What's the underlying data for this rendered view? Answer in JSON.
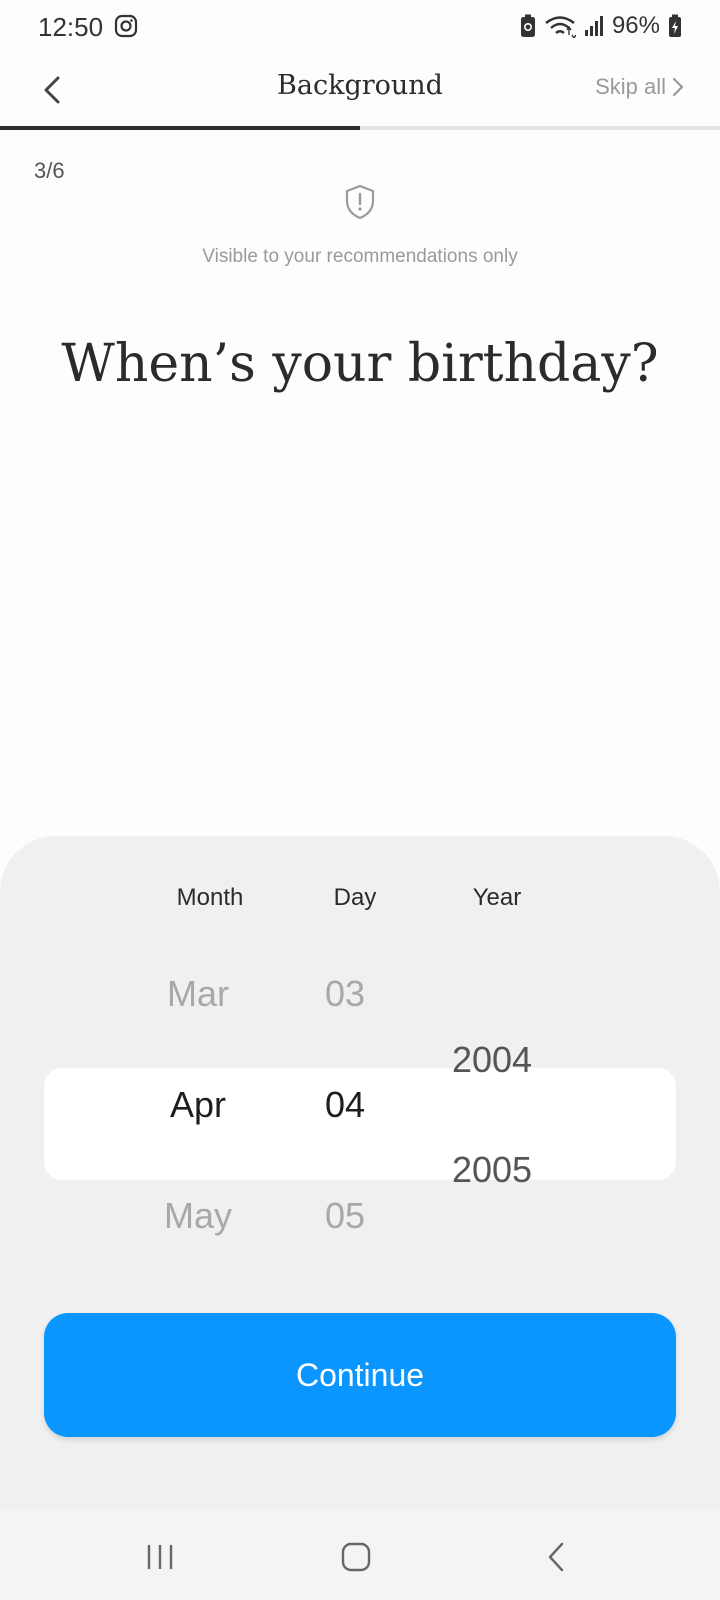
{
  "status_bar": {
    "time": "12:50",
    "battery": "96%",
    "icons": [
      "instagram-icon",
      "battery-saver-icon",
      "wifi-icon",
      "signal-icon",
      "battery-icon"
    ]
  },
  "header": {
    "title": "Background",
    "skip_label": "Skip all",
    "progress": 0.5
  },
  "content": {
    "step": "3/6",
    "privacy_note": "Visible to your recommendations only",
    "question": "When’s your birthday?"
  },
  "picker": {
    "headers": {
      "month": "Month",
      "day": "Day",
      "year": "Year"
    },
    "month": {
      "prev": "Mar",
      "selected": "Apr",
      "next": "May"
    },
    "day": {
      "prev": "03",
      "selected": "04",
      "next": "05"
    },
    "year": {
      "upper": "2004",
      "lower": "2005"
    }
  },
  "continue_label": "Continue",
  "colors": {
    "accent": "#0a96fe",
    "sheet": "#f0f0f0"
  }
}
